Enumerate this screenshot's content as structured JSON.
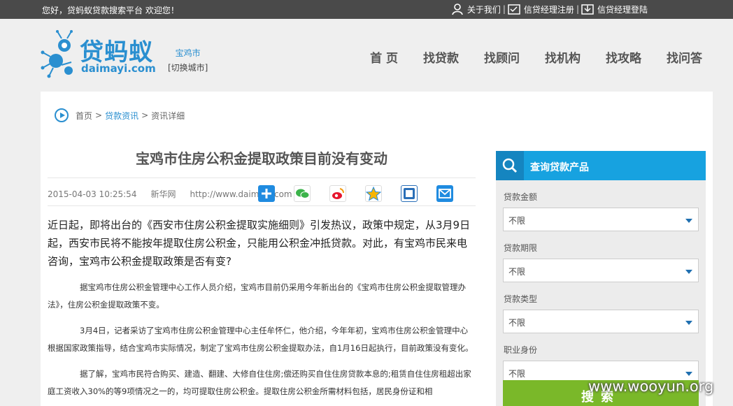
{
  "topbar": {
    "welcome": "您好，贷蚂蚁贷款搜索平台 欢迎您！",
    "links": [
      {
        "label": "关于我们",
        "icon": "user-icon"
      },
      {
        "label": "信贷经理注册",
        "icon": "register-icon"
      },
      {
        "label": "信贷经理登陆",
        "icon": "login-icon"
      }
    ],
    "separator": "|"
  },
  "logo": {
    "cn": "贷蚂蚁",
    "en": "daimayi.com"
  },
  "city": {
    "name": "宝鸡市",
    "switch": "[切换城市]"
  },
  "nav": [
    "首 页",
    "找贷款",
    "找顾问",
    "找机构",
    "找攻略",
    "找问答"
  ],
  "breadcrumb": {
    "home": "首页",
    "category": "贷款资讯",
    "current": "资讯详细",
    "sep": ">"
  },
  "article": {
    "title": "宝鸡市住房公积金提取政策目前没有变动",
    "date": "2015-04-03 10:25:54",
    "source": "新华网",
    "url": "http://www.daimayi.com",
    "lead": "近日起，即将出台的《西安市住房公积金提取实施细则》引发热议，政策中规定，从3月9日起，西安市民将不能按年提取住房公积金，只能用公积金冲抵贷款。对此，有宝鸡市民来电咨询，宝鸡市公积金提取政策是否有变?",
    "paragraphs": [
      "据宝鸡市住房公积金管理中心工作人员介绍，宝鸡市目前仍采用今年新出台的《宝鸡市住房公积金提取管理办法》，住房公积金提取政策不变。",
      "3月4日，记者采访了宝鸡市住房公积金管理中心主任牟怀仁，他介绍，今年年初，宝鸡市住房公积金管理中心根据国家政策指导，结合宝鸡市实际情况，制定了宝鸡市住房公积金提取办法，自1月16日起执行，目前政策没有变化。",
      "据了解，宝鸡市民符合购买、建造、翻建、大修自住住房;偿还购买自住住房贷款本息的;租赁自住住房租超出家庭工资收入30%的等9项情况之一的，均可提取住房公积金。提取住房公积金所需材料包括，居民身份证和相"
    ],
    "share_icons": [
      "qzone-plus-icon",
      "wechat-icon",
      "weibo-icon",
      "favorite-star-icon",
      "tieba-icon",
      "email-icon"
    ]
  },
  "panel": {
    "title": "查询贷款产品",
    "fields": [
      {
        "label": "贷款金额",
        "value": "不限"
      },
      {
        "label": "贷款期限",
        "value": "不限"
      },
      {
        "label": "贷款类型",
        "value": "不限"
      },
      {
        "label": "职业身份",
        "value": "不限"
      }
    ],
    "search_label": "搜索"
  },
  "watermark": "www.wooyun.org",
  "colors": {
    "accent": "#2a8fd0",
    "panel_header": "#17a2e0",
    "search_button": "#7ab829",
    "topbar": "#4a4a4a"
  }
}
